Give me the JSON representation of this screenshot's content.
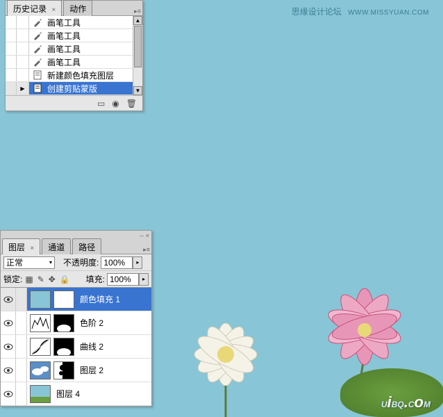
{
  "watermark": {
    "top_text": "思缘设计论坛",
    "top_url": "WWW.MISSYUAN.COM",
    "bottom_text": "UiBQ.CoM"
  },
  "history_panel": {
    "tabs": [
      {
        "label": "历史记录",
        "active": true
      },
      {
        "label": "动作",
        "active": false
      }
    ],
    "items": [
      {
        "icon": "brush",
        "label": "画笔工具"
      },
      {
        "icon": "brush",
        "label": "画笔工具"
      },
      {
        "icon": "brush",
        "label": "画笔工具"
      },
      {
        "icon": "brush",
        "label": "画笔工具"
      },
      {
        "icon": "doc",
        "label": "新建颜色填充图层"
      },
      {
        "icon": "doc",
        "label": "创建剪贴蒙版",
        "selected": true
      }
    ]
  },
  "layers_panel": {
    "tabs": [
      {
        "label": "图层",
        "active": true
      },
      {
        "label": "通道",
        "active": false
      },
      {
        "label": "路径",
        "active": false
      }
    ],
    "blend_mode": "正常",
    "opacity_label": "不透明度:",
    "opacity_value": "100%",
    "lock_label": "锁定:",
    "fill_label": "填充:",
    "fill_value": "100%",
    "layers": [
      {
        "name": "颜色填充 1",
        "selected": true,
        "thumb1": "solid-blue",
        "thumb2": "white"
      },
      {
        "name": "色阶 2",
        "thumb1": "levels",
        "thumb2": "mask"
      },
      {
        "name": "曲线 2",
        "thumb1": "curves",
        "thumb2": "mask"
      },
      {
        "name": "图层 2",
        "thumb1": "sky",
        "thumb2": "mask"
      },
      {
        "name": "图层 4",
        "thumb1": "img",
        "thumb2": null
      }
    ]
  }
}
